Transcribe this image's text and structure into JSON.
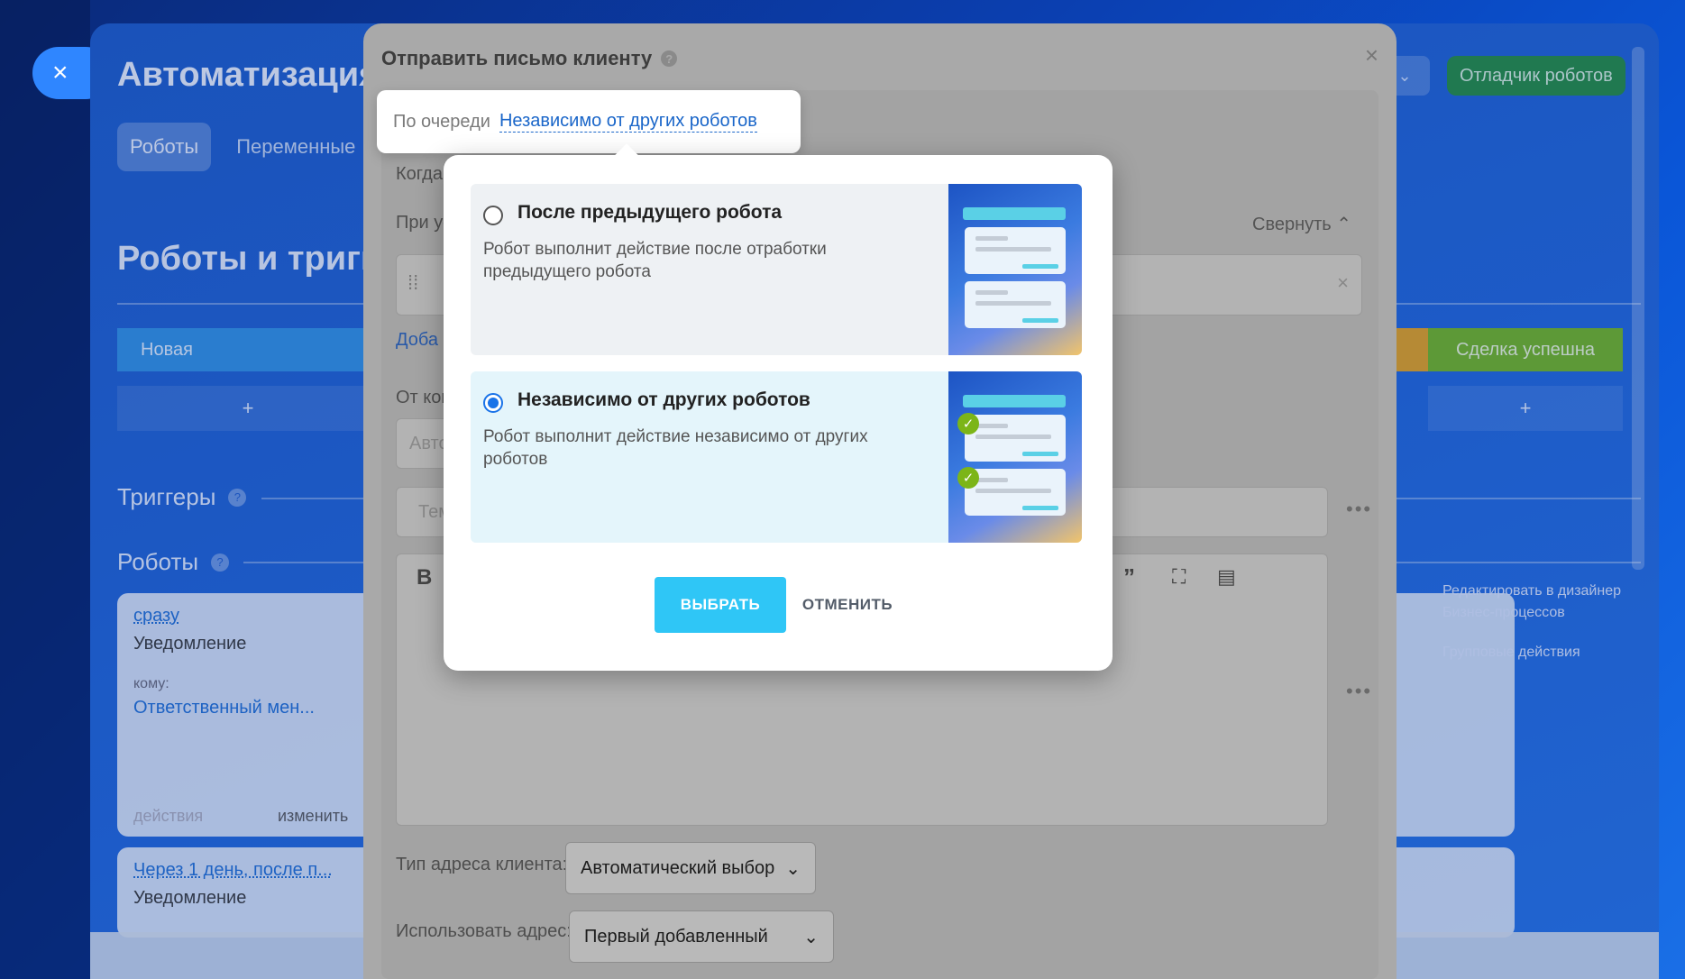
{
  "window": {
    "close_glyph": "×"
  },
  "app": {
    "title": "Автоматизация",
    "tabs": [
      "Роботы",
      "Переменные"
    ],
    "debugger_button": "Отладчик роботов",
    "section_title": "Роботы и тригг",
    "stages": {
      "first": "Новая",
      "last": "Сделка успешна"
    },
    "plus": "+",
    "triggers_label": "Триггеры",
    "robots_label": "Роботы",
    "card1": {
      "delay": "сразу",
      "name": "Уведомление",
      "to_label": "кому:",
      "to_value": "Ответственный мен...",
      "footer_left": "действия",
      "footer_right": "изменить"
    },
    "card2": {
      "delay": "Через 1 день, после п...",
      "name": "Уведомление"
    },
    "right_links": [
      "Редактировать в дизайнер Бизнес-процессов",
      "Групповые действия"
    ]
  },
  "dialog": {
    "title": "Отправить письмо клиенту",
    "close": "×",
    "when_label": "Когда",
    "condition_label": "При ус",
    "collapse_label": "Свернуть",
    "add_label": "Доба",
    "from_label": "От ког",
    "from_placeholder": "Авто",
    "subject_placeholder": "Тем",
    "client_address_type_label": "Тип адреса клиента:",
    "client_address_type_value": "Автоматический выбор",
    "use_address_label": "Использовать адрес:",
    "use_address_value": "Первый добавленный"
  },
  "queue": {
    "label": "По очереди",
    "value": "Независимо от других роботов"
  },
  "popup": {
    "options": [
      {
        "title": "После предыдущего робота",
        "description": "Робот выполнит действие после отработки предыдущего робота",
        "checked": false
      },
      {
        "title": "Независимо от других роботов",
        "description": "Робот выполнит действие независимо от других роботов",
        "checked": true
      }
    ],
    "select_button": "ВЫБРАТЬ",
    "cancel_button": "ОТМЕНИТЬ"
  },
  "colors": {
    "accent": "#2fc6f6",
    "link": "#1a66c9",
    "radio": "#1a73e8",
    "check": "#7cb518"
  },
  "icons": [
    "close-icon",
    "help-icon",
    "chevron-down-icon",
    "chevron-up-icon",
    "drag-handle-icon",
    "bold-icon",
    "quote-icon",
    "fullscreen-icon",
    "check-icon"
  ]
}
